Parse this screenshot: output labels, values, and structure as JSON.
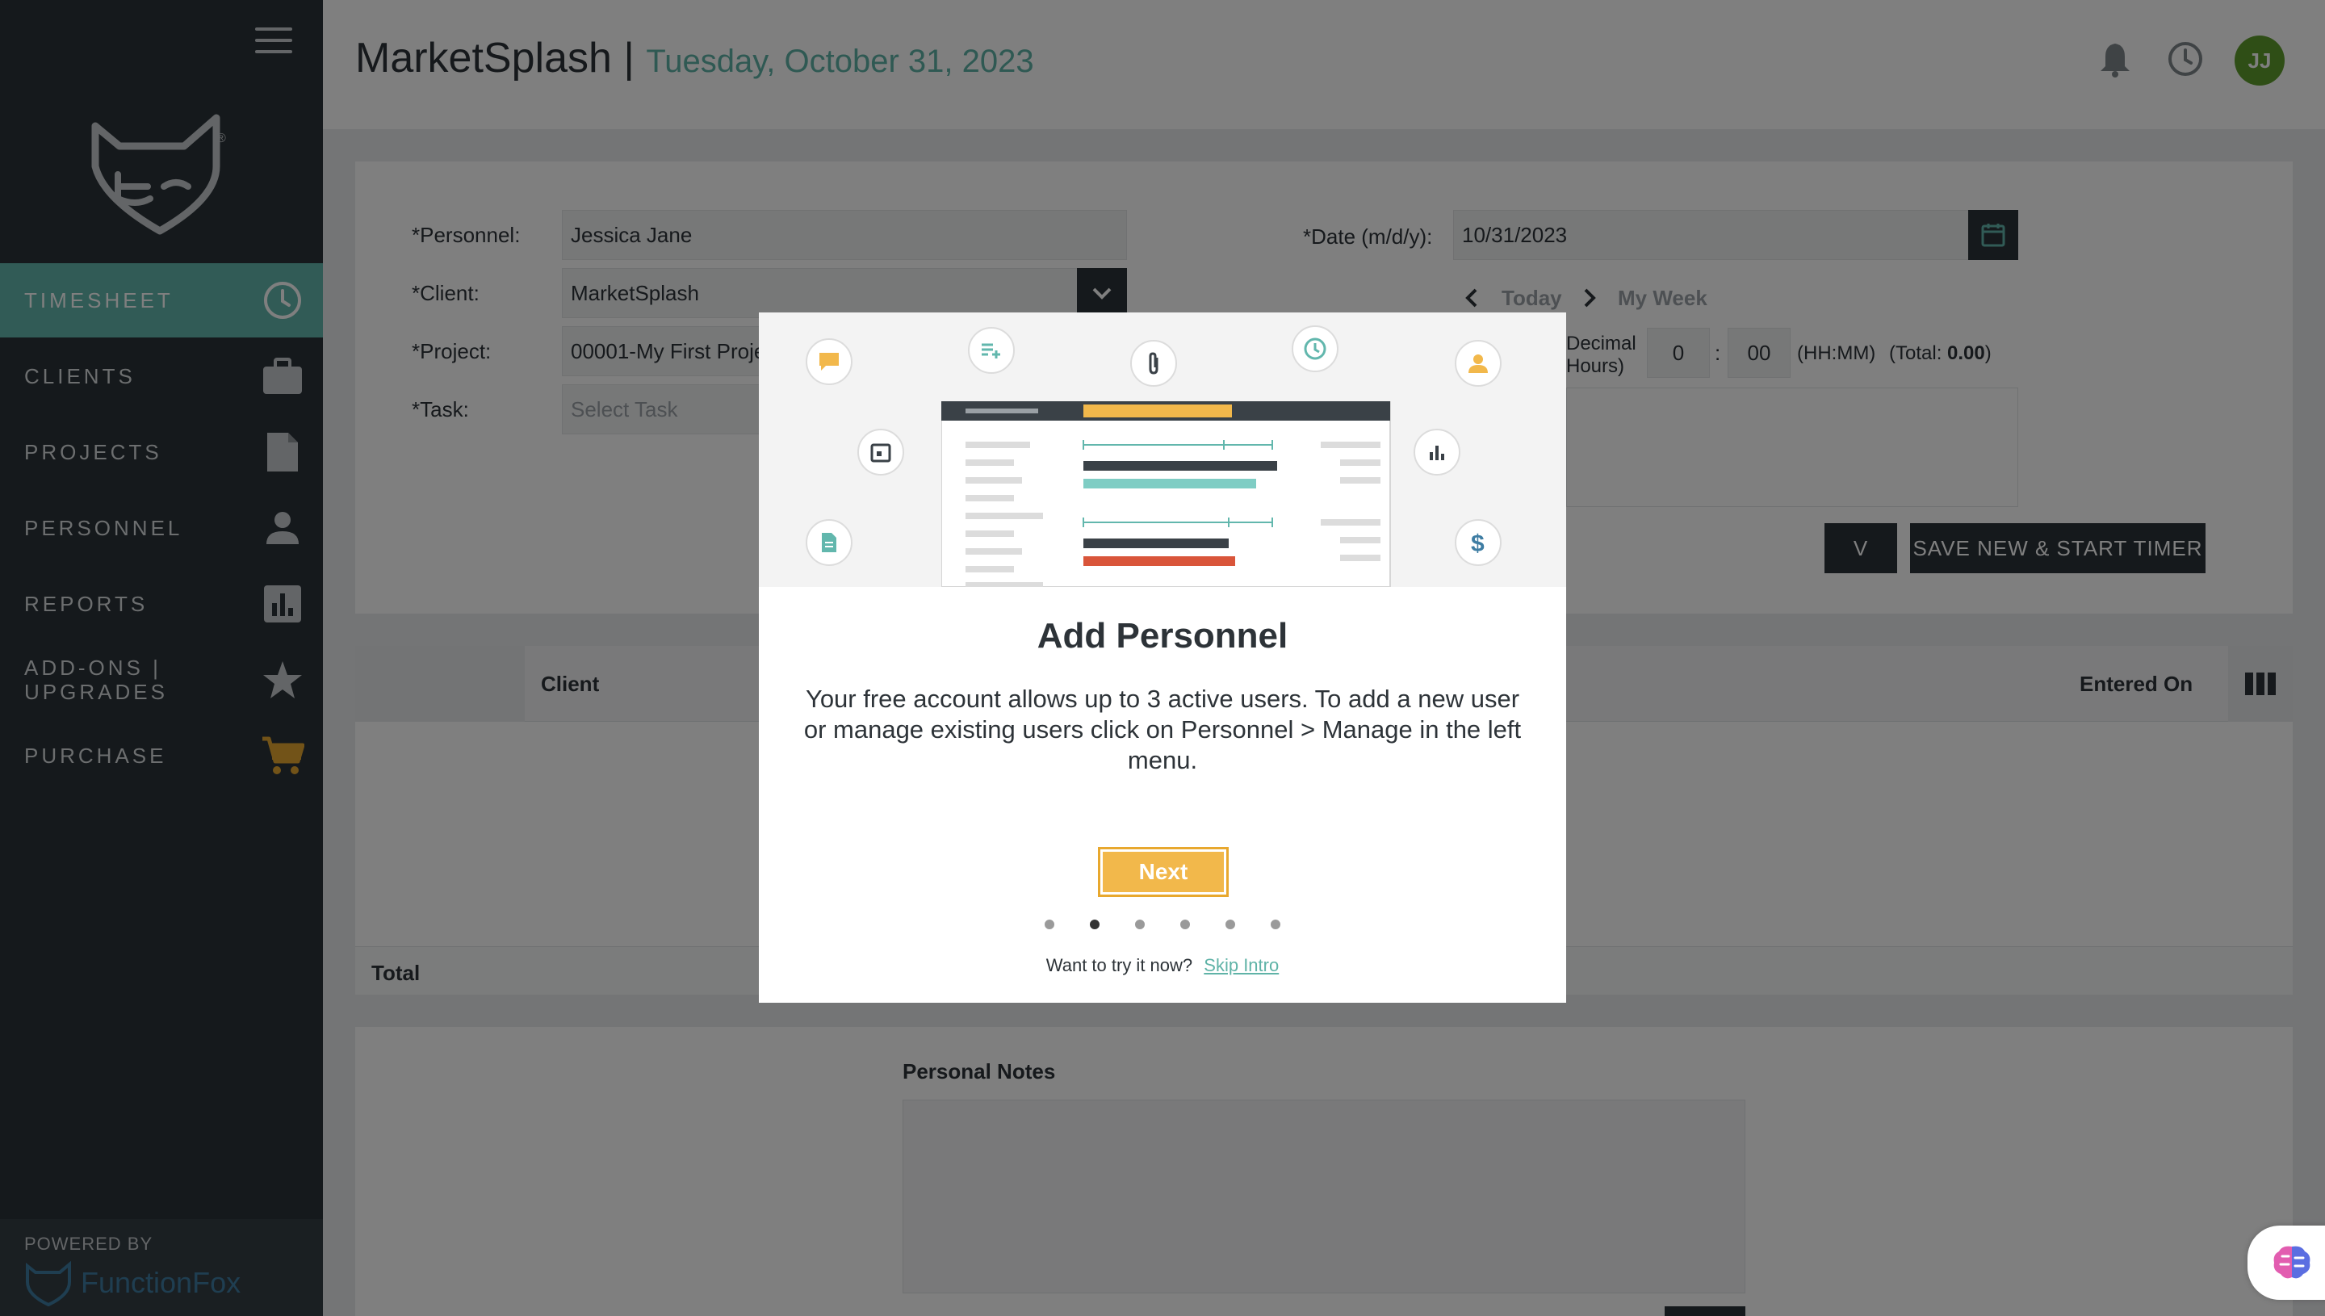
{
  "sidebar": {
    "items": [
      {
        "label": "TIMESHEET",
        "icon": "clock-icon"
      },
      {
        "label": "CLIENTS",
        "icon": "briefcase-icon"
      },
      {
        "label": "PROJECTS",
        "icon": "document-icon"
      },
      {
        "label": "PERSONNEL",
        "icon": "person-icon"
      },
      {
        "label": "REPORTS",
        "icon": "bar-chart-icon"
      },
      {
        "label": "ADD-ONS | UPGRADES",
        "icon": "star-icon"
      },
      {
        "label": "PURCHASE",
        "icon": "cart-icon"
      }
    ],
    "powered_by": "POWERED BY",
    "brand": "FunctionFox"
  },
  "header": {
    "title": "MarketSplash |",
    "date": "Tuesday, October 31, 2023",
    "avatar_initials": "JJ"
  },
  "form": {
    "personnel_label": "*Personnel:",
    "personnel_value": "Jessica Jane",
    "client_label": "*Client:",
    "client_value": "MarketSplash",
    "project_label": "*Project:",
    "project_value": "00001-My First Proje",
    "task_label": "*Task:",
    "task_placeholder": "Select Task",
    "date_label": "*Date (m/d/y):",
    "date_value": "10/31/2023",
    "today": "Today",
    "my_week": "My Week",
    "decimal_hours": "Decimal Hours)",
    "hours_value": "0",
    "minutes_value": "00",
    "hhmm": "(HH:MM)",
    "total_label": "(Total:",
    "total_value": "0.00",
    "total_close": ")",
    "save_new_partial": "V",
    "save_start_timer": "SAVE NEW & START TIMER"
  },
  "table": {
    "client_header": "Client",
    "entered_on_header": "Entered On",
    "total_label": "Total"
  },
  "notes": {
    "label": "Personal Notes"
  },
  "modal": {
    "title": "Add Personnel",
    "body": "Your free account allows up to 3 active users. To add a new user or manage existing users click on Personnel > Manage in the left menu.",
    "next_label": "Next",
    "dots_total": 6,
    "dots_active": 2,
    "try_text": "Want to try it now?",
    "skip_label": "Skip Intro"
  },
  "colors": {
    "sidebar_bg": "#2b3339",
    "accent_teal": "#62b7ad",
    "next_orange": "#f2b84b",
    "avatar_green": "#5e9c2d"
  }
}
